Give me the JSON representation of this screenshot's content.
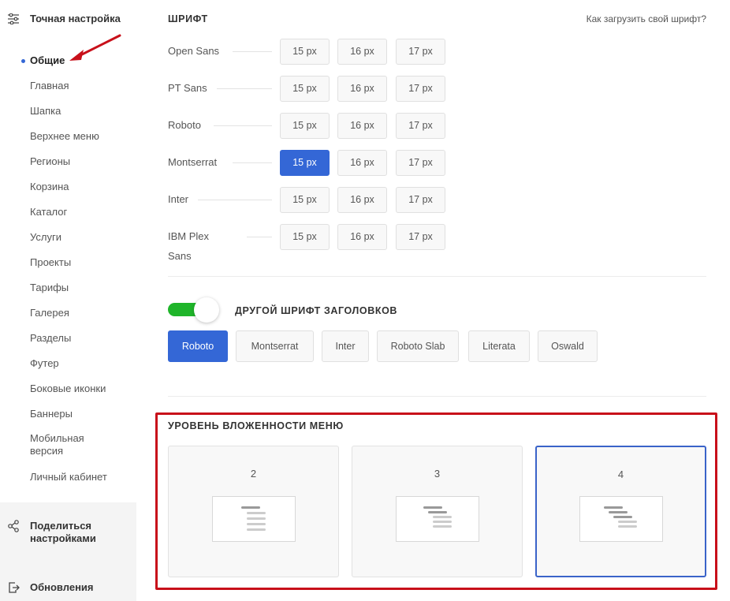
{
  "sidebar": {
    "title": "Точная настройка",
    "items": [
      {
        "label": "Общие",
        "active": true
      },
      {
        "label": "Главная"
      },
      {
        "label": "Шапка"
      },
      {
        "label": "Верхнее меню"
      },
      {
        "label": "Регионы"
      },
      {
        "label": "Корзина"
      },
      {
        "label": "Каталог"
      },
      {
        "label": "Услуги"
      },
      {
        "label": "Проекты"
      },
      {
        "label": "Тарифы"
      },
      {
        "label": "Галерея"
      },
      {
        "label": "Разделы"
      },
      {
        "label": "Футер"
      },
      {
        "label": "Боковые иконки"
      },
      {
        "label": "Баннеры"
      },
      {
        "label": "Мобильная версия"
      },
      {
        "label": "Личный кабинет"
      }
    ],
    "share_label": "Поделиться настройками",
    "updates_label": "Обновления",
    "active_dot_color": "#3467d6"
  },
  "font_section": {
    "title": "ШРИФТ",
    "upload_link": "Как загрузить свой шрифт?",
    "fonts": [
      {
        "name": "Open Sans",
        "sizes": [
          "15 px",
          "16 px",
          "17 px"
        ],
        "selected": null
      },
      {
        "name": "PT Sans",
        "sizes": [
          "15 px",
          "16 px",
          "17 px"
        ],
        "selected": null
      },
      {
        "name": "Roboto",
        "sizes": [
          "15 px",
          "16 px",
          "17 px"
        ],
        "selected": null
      },
      {
        "name": "Montserrat",
        "sizes": [
          "15 px",
          "16 px",
          "17 px"
        ],
        "selected": "15 px"
      },
      {
        "name": "Inter",
        "sizes": [
          "15 px",
          "16 px",
          "17 px"
        ],
        "selected": null
      },
      {
        "name": "IBM Plex Sans",
        "sizes": [
          "15 px",
          "16 px",
          "17 px"
        ],
        "selected": null
      }
    ]
  },
  "heading_font": {
    "toggle_on": true,
    "label": "ДРУГОЙ ШРИФТ ЗАГОЛОВКОВ",
    "options": [
      "Roboto",
      "Montserrat",
      "Inter",
      "Roboto Slab",
      "Literata",
      "Oswald"
    ],
    "selected": "Roboto"
  },
  "menu_depth": {
    "title": "УРОВЕНЬ ВЛОЖЕННОСТИ МЕНЮ",
    "levels": [
      "2",
      "3",
      "4"
    ],
    "selected": "4"
  },
  "colors": {
    "accent": "#3467d6",
    "toggle_on": "#1fb52a",
    "highlight_box": "#c8101a",
    "annotation_arrow": "#c8101a"
  }
}
